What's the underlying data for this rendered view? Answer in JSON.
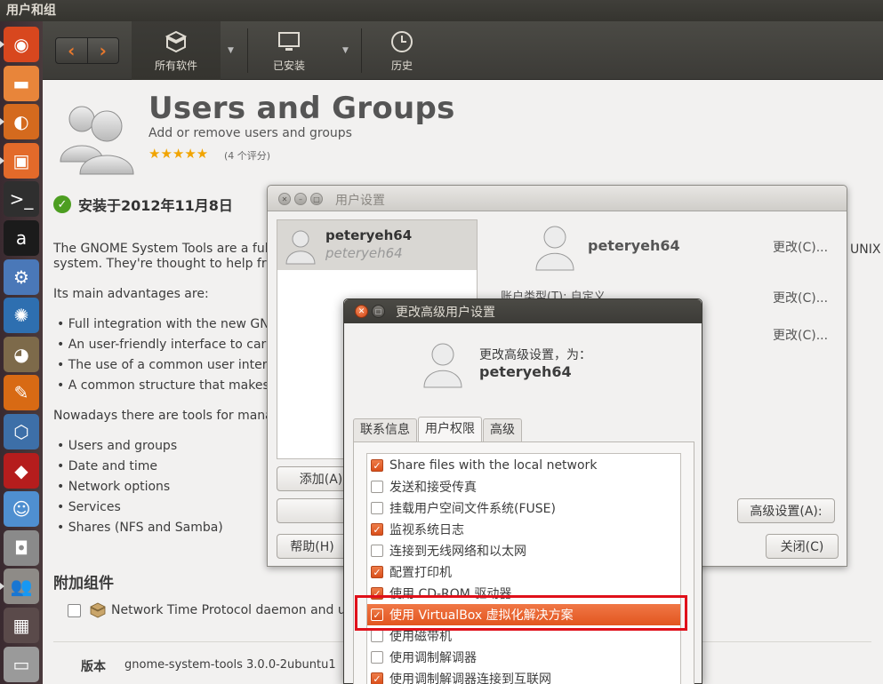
{
  "top_panel": {
    "title": "用户和组"
  },
  "launcher": {
    "items": [
      {
        "name": "dash-home-icon",
        "glyph": "◉",
        "bg": "#d8471e"
      },
      {
        "name": "files-icon",
        "glyph": "▬",
        "bg": "#e8853a"
      },
      {
        "name": "firefox-icon",
        "glyph": "◐",
        "bg": "#d46a1e"
      },
      {
        "name": "software-center-icon",
        "glyph": "▣",
        "bg": "#e36a2a"
      },
      {
        "name": "terminal-icon",
        "glyph": ">_",
        "bg": "#2f2f2f"
      },
      {
        "name": "app-a-icon",
        "glyph": "a",
        "bg": "#1b1b1b"
      },
      {
        "name": "settings-tools-icon",
        "glyph": "⚙",
        "bg": "#4a78b8"
      },
      {
        "name": "shutter-icon",
        "glyph": "✺",
        "bg": "#2e6fb0"
      },
      {
        "name": "gimp-icon",
        "glyph": "◕",
        "bg": "#7d6a4a"
      },
      {
        "name": "inkscape-icon",
        "glyph": "✎",
        "bg": "#d86a14"
      },
      {
        "name": "virtualbox-icon",
        "glyph": "⬡",
        "bg": "#3d6fa8"
      },
      {
        "name": "wine-icon",
        "glyph": "◆",
        "bg": "#b51d1d"
      },
      {
        "name": "chat-icon",
        "glyph": "☺",
        "bg": "#4f8fd0"
      },
      {
        "name": "camera-icon",
        "glyph": "◘",
        "bg": "#8a8a8a"
      },
      {
        "name": "users-groups-icon",
        "glyph": "👥",
        "bg": "#8e8b87"
      },
      {
        "name": "workspace-switcher-icon",
        "glyph": "▦",
        "bg": "#5a4a4a"
      },
      {
        "name": "drive-icon",
        "glyph": "▭",
        "bg": "#9a9a9a"
      }
    ]
  },
  "software_center": {
    "toolbar": {
      "back": "‹",
      "forward": "›",
      "all_software": "所有软件",
      "installed": "已安装",
      "history": "历史"
    },
    "app": {
      "title": "Users and Groups",
      "subtitle": "Add or remove users and groups",
      "stars": "★★★★★",
      "rating_count": "(4 个评分)",
      "installed_on": "安装于2012年11月8日"
    },
    "description": {
      "p1_line1": "The GNOME System Tools are a fully",
      "p1_line2": "system. They're thought to help fron",
      "p1_end": "UNIX",
      "p2": "Its main advantages are:",
      "bullets1": [
        "Full integration with the new GNO",
        "An user-friendly interface to carry",
        "The use of a common user interfa",
        "A common structure that makes e"
      ],
      "p3": "Nowadays there are tools for manag",
      "bullets2": [
        "Users and groups",
        "Date and time",
        "Network options",
        "Services",
        "Shares (NFS and Samba)"
      ]
    },
    "addons": {
      "heading": "附加组件",
      "item": "Network Time Protocol daemon and ut"
    },
    "version": {
      "label": "版本",
      "value": "gnome-system-tools 3.0.0-2ubuntu1"
    }
  },
  "user_settings": {
    "title": "用户设置",
    "list_user_name": "peteryeh64",
    "list_user_login": "peteryeh64",
    "user_name": "peteryeh64",
    "change1": "更改(C)...",
    "change2": "更改(C)...",
    "change3": "更改(C)...",
    "account_type_fragment": "账户类型(T):   自定义",
    "add_button": "添加(A)",
    "help_button": "帮助(H)",
    "advanced_button": "高级设置(A):",
    "close_button": "关闭(C)"
  },
  "advanced_dialog": {
    "title": "更改高级用户设置",
    "heading": "更改高级设置，为：",
    "user": "peteryeh64",
    "tabs": [
      "联系信息",
      "用户权限",
      "高级"
    ],
    "active_tab": "用户权限",
    "permissions": [
      {
        "label": "Share files with the local network",
        "checked": true
      },
      {
        "label": "发送和接受传真",
        "checked": false
      },
      {
        "label": "挂载用户空间文件系统(FUSE)",
        "checked": false
      },
      {
        "label": "监视系统日志",
        "checked": true
      },
      {
        "label": "连接到无线网络和以太网",
        "checked": false
      },
      {
        "label": "配置打印机",
        "checked": true
      },
      {
        "label": "使用 CD-ROM 驱动器",
        "checked": true
      },
      {
        "label": "使用 VirtualBox 虚拟化解决方案",
        "checked": true,
        "selected": true
      },
      {
        "label": "使用磁带机",
        "checked": false
      },
      {
        "label": "使用调制解调器",
        "checked": false
      },
      {
        "label": "使用调制解调器连接到互联网",
        "checked": true
      }
    ]
  },
  "colors": {
    "accent": "#e2561f",
    "highlight_box": "#e0101a",
    "star": "#f1a400",
    "installed_check": "#4d9e21"
  }
}
